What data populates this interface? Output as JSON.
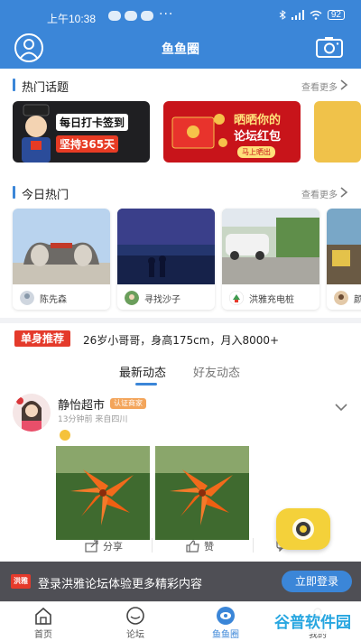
{
  "status_bar": {
    "time": "上午10:38",
    "more": "···",
    "battery": "92"
  },
  "header": {
    "title": "鱼鱼圈"
  },
  "hot_topics": {
    "title": "热门话题",
    "more": "查看更多",
    "banners": [
      {
        "line1": "每日打卡签到",
        "line2": "坚持365天"
      },
      {
        "line1": "晒晒你的",
        "line2": "论坛红包",
        "button": "马上晒出"
      }
    ]
  },
  "today_hot": {
    "title": "今日热门",
    "more": "查看更多",
    "cards": [
      {
        "user": "陈先森"
      },
      {
        "user": "寻找沙子"
      },
      {
        "user": "洪雅充电桩"
      },
      {
        "user": "颜"
      }
    ]
  },
  "singles": {
    "badge": "单身推荐",
    "text": "26岁小哥哥，身高175cm，月入8000+"
  },
  "feed_tabs": {
    "tabs": [
      "最新动态",
      "好友动态"
    ]
  },
  "post": {
    "name": "静怡超市",
    "badge": "认证商家",
    "meta": "13分钟前  来自四川"
  },
  "actions": {
    "share": "分享",
    "like": "赞"
  },
  "login_bar": {
    "logo": "洪雅",
    "text": "登录洪雅论坛体验更多精彩内容",
    "button": "立即登录"
  },
  "tabbar": {
    "items": [
      "首页",
      "论坛",
      "鱼鱼圈",
      "我的"
    ]
  },
  "watermark": "谷普软件园",
  "colors": {
    "primary": "#3b86d8",
    "badge_red": "#e43a2b",
    "fab_yellow": "#f4d13a"
  }
}
